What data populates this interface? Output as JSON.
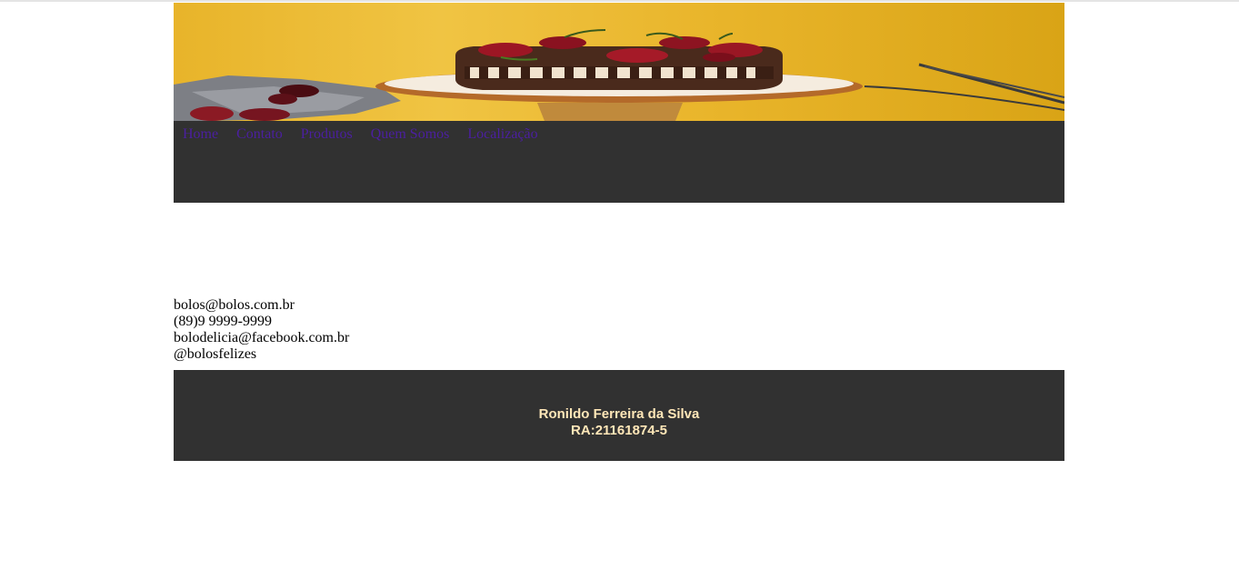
{
  "banner": {
    "alt": "chocolate cake with cherries on a cake stand"
  },
  "nav": {
    "items": [
      {
        "label": "Home"
      },
      {
        "label": "Contato"
      },
      {
        "label": "Produtos"
      },
      {
        "label": "Quem Somos"
      },
      {
        "label": "Localização"
      }
    ],
    "link_color": "#4b1fa0",
    "background": "#313131"
  },
  "contact": {
    "email": "bolos@bolos.com.br",
    "phone": "(89)9 9999-9999",
    "facebook": "bolodelicia@facebook.com.br",
    "instagram": "@bolosfelizes"
  },
  "footer": {
    "name": "Ronildo Ferreira da Silva",
    "ra": "RA:21161874-5",
    "text_color": "#ffe7b8"
  }
}
